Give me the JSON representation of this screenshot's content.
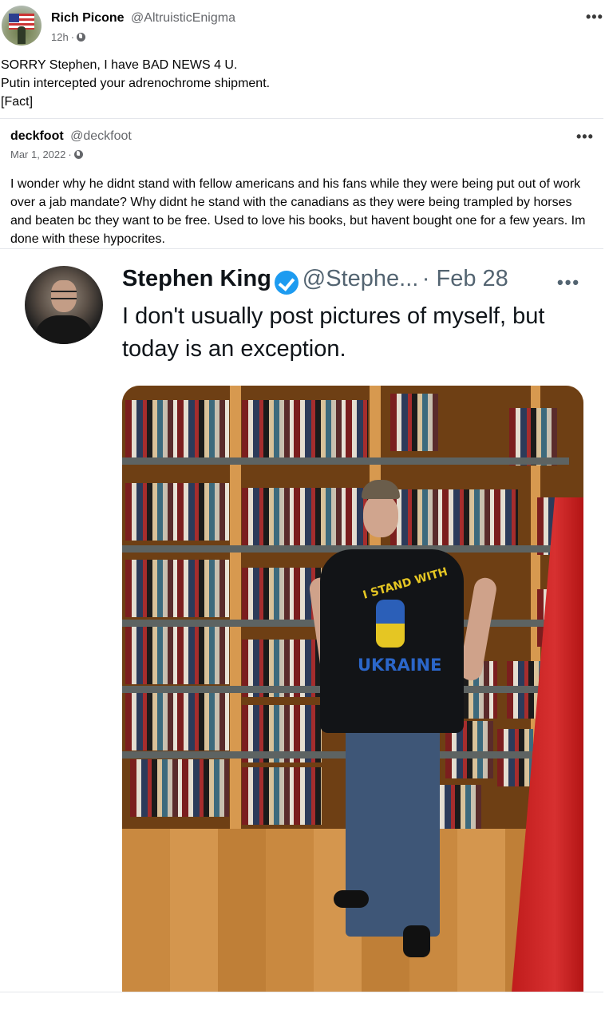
{
  "post": {
    "author_name": "Rich Picone",
    "author_handle": "@AltruisticEnigma",
    "time": "12h",
    "separator": "·",
    "body_lines": [
      "SORRY Stephen, I have BAD NEWS 4 U.",
      "Putin intercepted your adrenochrome shipment.",
      "[Fact]"
    ],
    "more_icon": "more-dots-icon",
    "audience_icon": "globe-icon"
  },
  "quoted": {
    "author_name": "deckfoot",
    "author_handle": "@deckfoot",
    "date": "Mar 1, 2022",
    "separator": "·",
    "body": "I wonder why he didnt stand with fellow americans and his fans while they were being put out of work over a jab mandate? Why didnt he stand with the canadians as they were being trampled by horses and beaten bc they want to be free. Used to love his books, but havent bought one for a few years. Im done with these hypocrites."
  },
  "tweet": {
    "author_name": "Stephen King",
    "author_handle": "@Stephe...",
    "date": "· Feb 28",
    "text_lines": [
      "I don't usually post pictures of myself, but",
      "today is an exception."
    ],
    "verified_color": "#1d9bf0",
    "shirt_text_top": "I STAND WITH",
    "shirt_text_bottom": "UKRAINE"
  },
  "colors": {
    "text": "#050505",
    "secondary": "#65676b",
    "divider": "#e4e6eb",
    "tweet_secondary": "#536471"
  }
}
